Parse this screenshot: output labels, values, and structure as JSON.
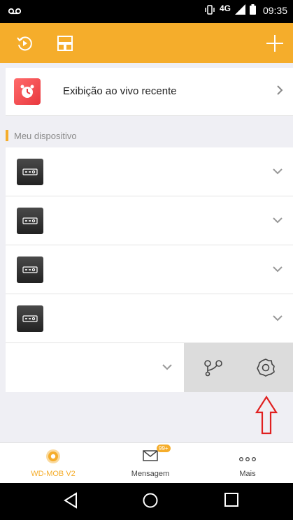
{
  "status_bar": {
    "network": "4G",
    "time": "09:35"
  },
  "app_bar": {
    "icons": [
      "replay-icon",
      "layout-icon",
      "plus-icon"
    ]
  },
  "recent_live": {
    "label": "Exibição ao vivo recente"
  },
  "section": {
    "title": "Meu dispositivo"
  },
  "devices": [
    {},
    {},
    {},
    {}
  ],
  "tabs": [
    {
      "label": "WD-MOB V2",
      "color": "#f5ad2b"
    },
    {
      "label": "Mensagem",
      "badge": "99+"
    },
    {
      "label": "Mais"
    }
  ],
  "colors": {
    "accent": "#f5ad2b",
    "red_annotation": "#e02020"
  }
}
